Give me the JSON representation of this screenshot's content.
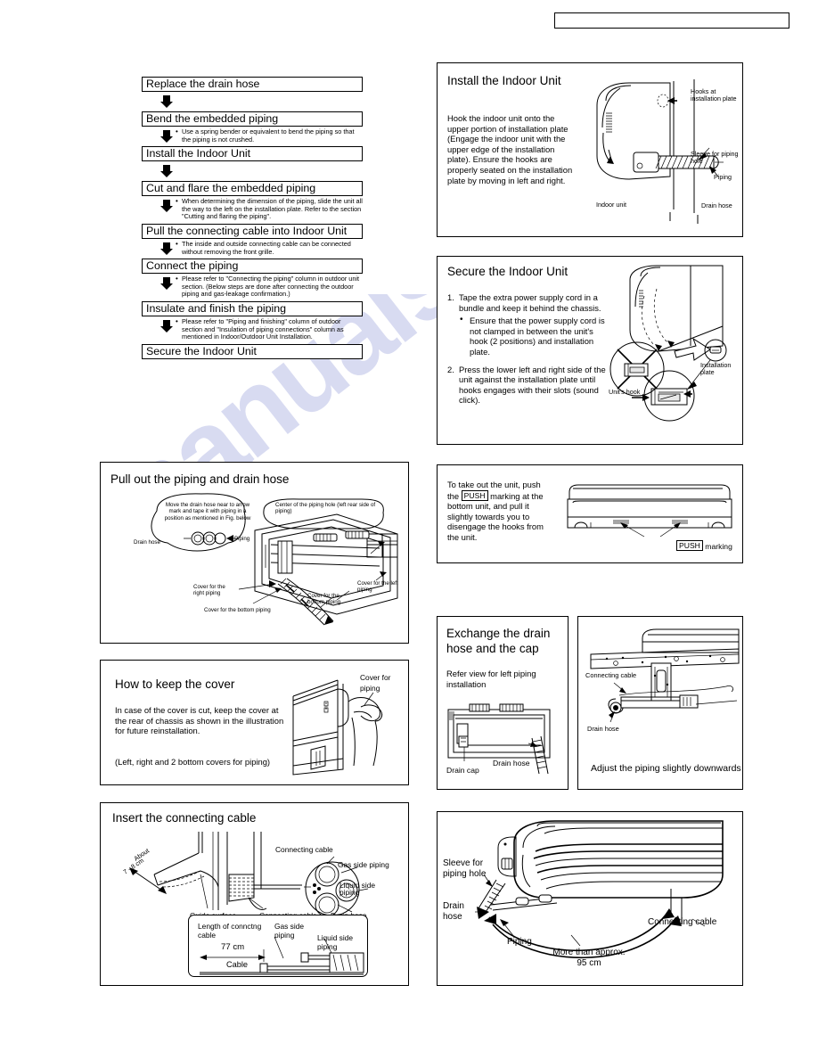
{
  "header": {
    "box_label": ""
  },
  "flowchart": {
    "steps": [
      {
        "label": "Replace the drain hose",
        "note": ""
      },
      {
        "label": "Bend the embedded piping",
        "note": "Use a spring bender or equivalent to bend the piping so that the piping is not crushed."
      },
      {
        "label": "Install the Indoor Unit",
        "note": ""
      },
      {
        "label": "Cut and flare the embedded piping",
        "note": "When determining the dimension of the piping, slide the unit all the way to the left on the installation plate. Refer to the section \"Cutting and flaring the piping\"."
      },
      {
        "label": "Pull the connecting cable into Indoor Unit",
        "note": "The inside and outside connecting cable can be connected without removing the front grille."
      },
      {
        "label": "Connect the piping",
        "note": "Please refer to \"Connecting the piping\" column in outdoor unit section. (Below steps are done after connecting the outdoor piping and gas-leakage confirmation.)"
      },
      {
        "label": "Insulate and finish the piping",
        "note": "Please refer to \"Piping and finishing\" column of outdoor section and \"Insulation of piping connections\" column as mentioned in Indoor/Outdoor Unit Installation."
      },
      {
        "label": "Secure the Indoor Unit",
        "note": ""
      }
    ]
  },
  "install_indoor_unit": {
    "title": "Install the Indoor Unit",
    "body": "Hook the indoor unit onto the upper portion of installation plate (Engage the indoor unit with the upper edge of the installation plate). Ensure the hooks are properly seated on the installation plate by moving in left and right.",
    "labels": {
      "hooks": "Hooks at installation plate",
      "sleeve": "Sleeve for piping hole",
      "piping": "Piping",
      "drain_hose": "Drain hose",
      "indoor_unit": "Indoor unit"
    }
  },
  "secure_indoor_unit": {
    "title": "Secure the Indoor Unit",
    "item1": "Tape the extra power supply cord in a bundle and keep it behind the chassis.",
    "item1_bullet": "Ensure that the power supply cord is not clamped in between the unit's hook (2 positions) and installation plate.",
    "item2": "Press the lower left and right side of the unit against the installation plate until hooks engages with their slots (sound click).",
    "num1": "1.",
    "num2": "2.",
    "labels": {
      "units_hook": "Unit's hook",
      "installation_plate": "Installation plate"
    }
  },
  "push_panel": {
    "text_before": "To take out the unit, push the",
    "push_tag": "PUSH",
    "text_after": "marking at the bottom unit, and pull it slightly towards you to disengage the hooks from the unit.",
    "caption_tag": "PUSH",
    "caption_text": "marking"
  },
  "pull_out_piping": {
    "title": "Pull out the piping and drain hose",
    "bubble_left": "Move the drain hose near to arrow mark and tape it with piping in a position as mentioned in Fig. below",
    "bubble_right": "Center of the piping hole (left rear side of piping)",
    "labels": {
      "drain_hose": "Drain hose",
      "piping": "Piping",
      "cover_right": "Cover for the right piping",
      "cover_bottom": "Cover for the bottom piping",
      "cover_bottom2": "Cover for the bottom piping",
      "cover_left": "Cover  for the left piping"
    }
  },
  "keep_cover": {
    "title": "How to keep the cover",
    "body": "In case of the cover is cut, keep the cover at the rear of chassis as shown in the illustration for future reinstallation.",
    "footnote": "(Left, right and 2 bottom covers for piping)",
    "label_cover": "Cover for piping"
  },
  "insert_cable": {
    "title": "Insert the connecting cable",
    "labels": {
      "about": "About",
      "dim_7_8": "7 - 8 cm",
      "guide_surface": "Guide surface",
      "connecting_cable_1": "Connecting cable",
      "connecting_cable_2": "Connecting cable",
      "connecting_cable_3": "Connecting cable",
      "gas_side": "Gas side piping",
      "liquid_side": "Liquid side piping",
      "drain_hose": "Drain hose"
    },
    "inner": {
      "length_label": "Length of connctng cable",
      "dimension": "77 cm",
      "cable": "Cable",
      "gas_side": "Gas side piping",
      "liquid_side": "Liquid side piping"
    }
  },
  "exchange_drain": {
    "title": "Exchange the drain hose and the cap",
    "subtitle": "Refer view for left piping installation",
    "labels": {
      "drain_cap": "Drain cap",
      "drain_hose": "Drain hose"
    }
  },
  "adjust_piping": {
    "caption": "Adjust the piping slightly downwards",
    "labels": {
      "connecting_cable": "Connecting cable",
      "drain_hose": "Drain hose"
    }
  },
  "bottom_unit": {
    "labels": {
      "sleeve": "Sleeve for piping hole",
      "drain_hose": "Drain hose",
      "piping": "Piping",
      "more_than": "More than approx. 95 cm",
      "connecting_cable": "Connecting cable"
    }
  },
  "watermark": {
    "text": "manualshive.com"
  }
}
